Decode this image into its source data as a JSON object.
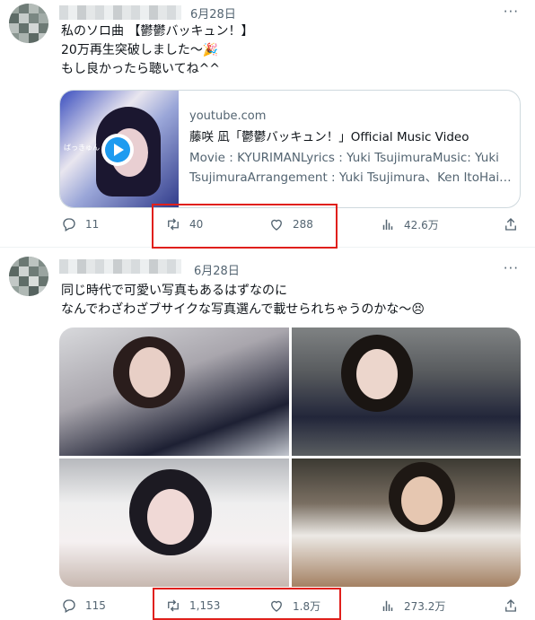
{
  "tweets": [
    {
      "date": "6月28日",
      "more": "···",
      "lines": [
        "私のソロ曲 【鬱鬱バッキュン！】",
        "20万再生突破しました〜🎉",
        "もし良かったら聴いてね^^"
      ],
      "card": {
        "domain": "youtube.com",
        "title": "藤咲 凪「鬱鬱バッキュン！」Official Music Video",
        "desc_line1": "Movie : KYURIMANLyrics : Yuki TsujimuraMusic: Yuki",
        "desc_line2": "TsujimuraArrangement : Yuki Tsujimura、Ken ItoHair…",
        "thumb_text": "ばっきゅん"
      },
      "actions": {
        "replies": "11",
        "retweets": "40",
        "likes": "288",
        "views": "42.6万"
      }
    },
    {
      "date": "6月28日",
      "more": "···",
      "lines": [
        "同じ時代で可愛い写真もあるはずなのに",
        "なんでわざわざブサイクな写真選んで載せられちゃうのかな〜😣"
      ],
      "actions": {
        "replies": "115",
        "retweets": "1,153",
        "likes": "1.8万",
        "views": "273.2万"
      }
    }
  ],
  "icons": [
    "reply-icon",
    "retweet-icon",
    "like-icon",
    "views-icon",
    "share-icon",
    "play-icon"
  ],
  "colors": {
    "highlight": "#e0201c",
    "accent": "#1d9bf0",
    "muted": "#536471"
  }
}
